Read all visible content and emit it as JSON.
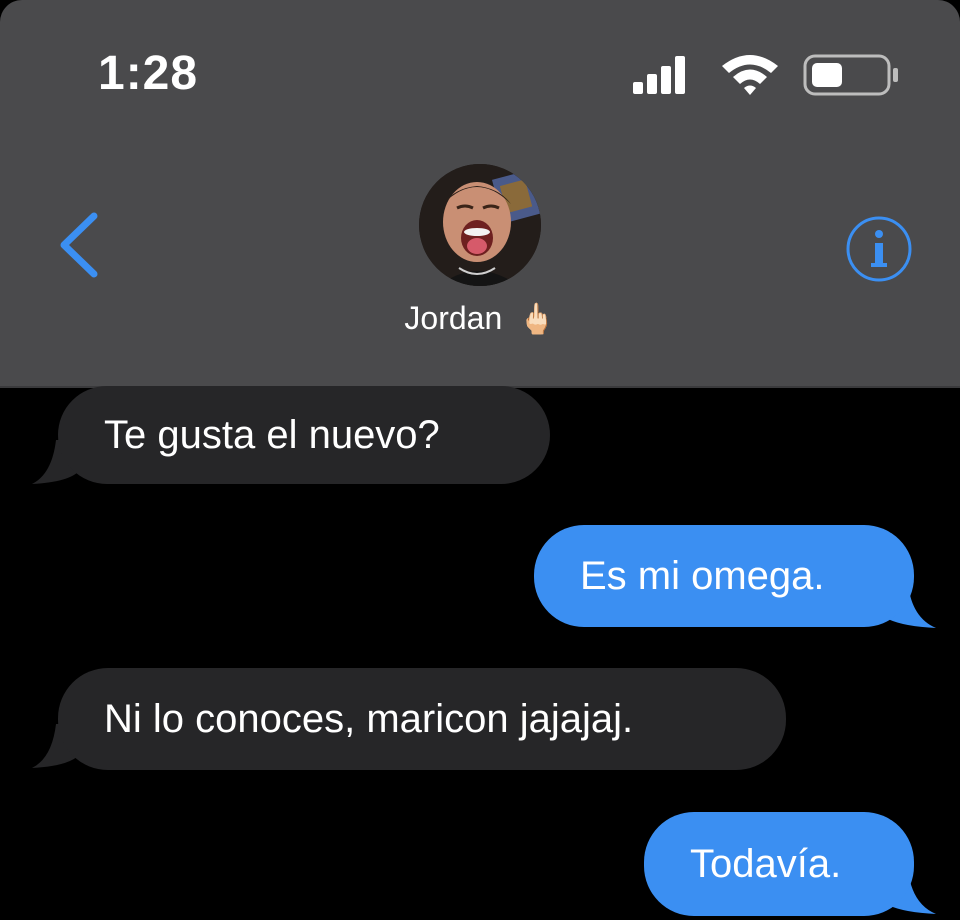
{
  "status_bar": {
    "time": "1:28",
    "icons": [
      "signal-icon",
      "wifi-icon",
      "battery-icon"
    ]
  },
  "nav": {
    "back_icon": "chevron-left-icon",
    "info_icon": "info-icon",
    "contact_name": "Jordan",
    "contact_emoji": "🖕🏻"
  },
  "messages": [
    {
      "direction": "received",
      "text": "Te gusta el nuevo?"
    },
    {
      "direction": "sent",
      "text": "Es mi omega."
    },
    {
      "direction": "received",
      "text": "Ni lo conoces, maricon jajajaj."
    },
    {
      "direction": "sent",
      "text": "Todavía."
    }
  ],
  "colors": {
    "header_bg": "#4a4a4c",
    "accent_blue": "#3b8ff2",
    "received_bubble": "#262628",
    "background": "#000000"
  }
}
